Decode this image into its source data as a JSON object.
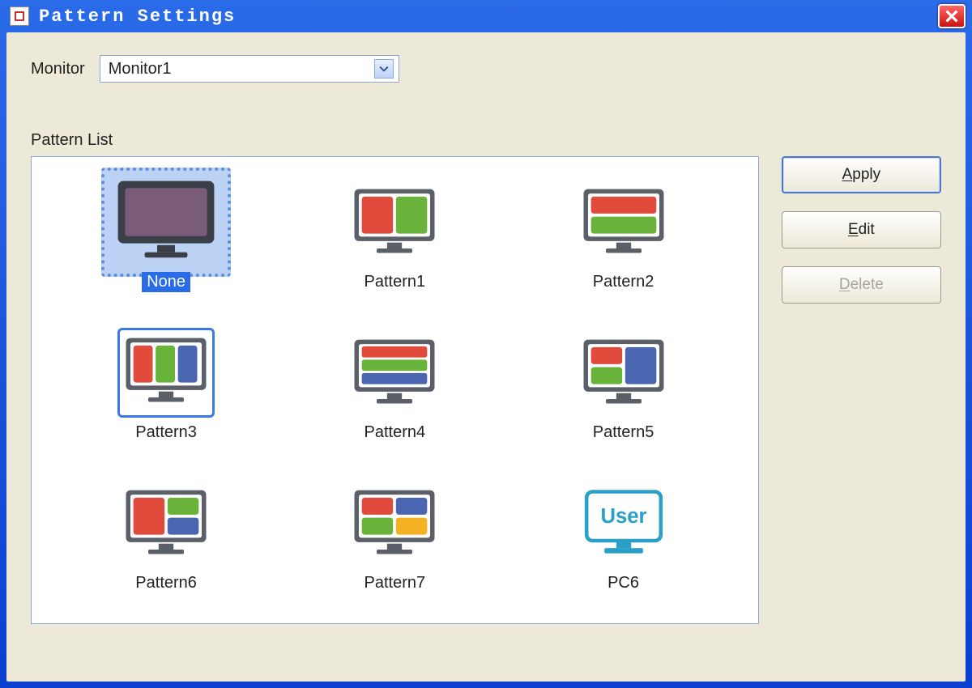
{
  "window": {
    "title": "Pattern Settings"
  },
  "monitor": {
    "label": "Monitor",
    "selected": "Monitor1"
  },
  "section_label": "Pattern List",
  "buttons": {
    "apply": "Apply",
    "edit": "Edit",
    "delete": "Delete"
  },
  "patterns": {
    "none": "None",
    "pattern1": "Pattern1",
    "pattern2": "Pattern2",
    "pattern3": "Pattern3",
    "pattern4": "Pattern4",
    "pattern5": "Pattern5",
    "pattern6": "Pattern6",
    "pattern7": "Pattern7",
    "user": "PC6",
    "user_icon_text": "User"
  },
  "colors": {
    "red": "#e14b3b",
    "green": "#6ab33a",
    "blue": "#4a66b0",
    "yellow": "#f4b223",
    "bezel": "#5a5f68",
    "screen": "#ffffff",
    "teal": "#2aa0c8",
    "none_bg": "#7a5b7a"
  }
}
